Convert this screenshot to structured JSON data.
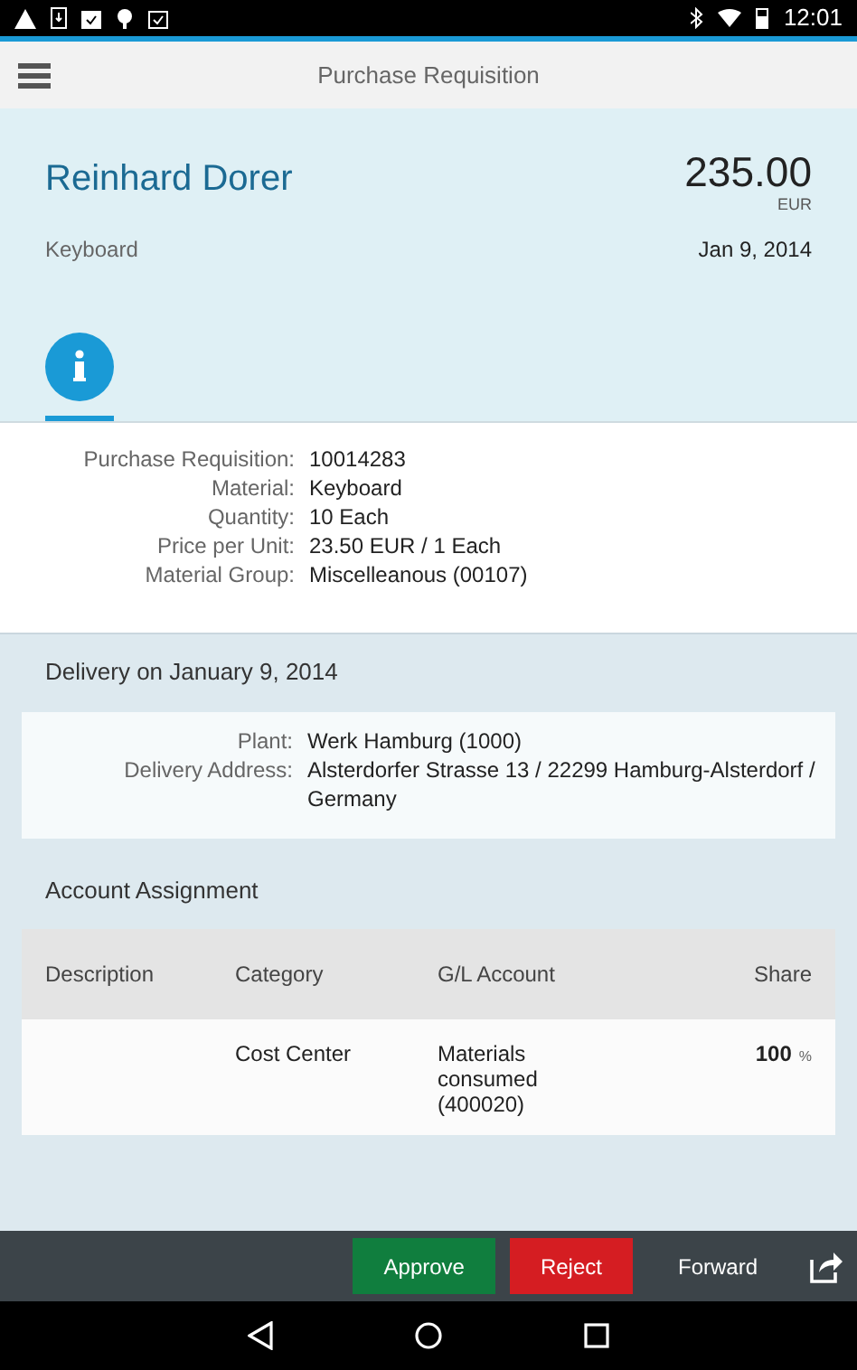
{
  "status_bar": {
    "time": "12:01"
  },
  "header": {
    "title": "Purchase Requisition"
  },
  "summary": {
    "name": "Reinhard Dorer",
    "amount": "235.00",
    "currency": "EUR",
    "item": "Keyboard",
    "date": "Jan 9, 2014"
  },
  "tabs": [
    {
      "kind": "info",
      "selected": true
    }
  ],
  "details": [
    {
      "label": "Purchase Requisition:",
      "value": "10014283"
    },
    {
      "label": "Material:",
      "value": "Keyboard"
    },
    {
      "label": "Quantity:",
      "value": "10 Each"
    },
    {
      "label": "Price per Unit:",
      "value": "23.50 EUR / 1 Each"
    },
    {
      "label": "Material Group:",
      "value": "Miscelleanous (00107)"
    }
  ],
  "delivery": {
    "title": "Delivery on January 9, 2014",
    "fields": [
      {
        "label": "Plant:",
        "value": "Werk Hamburg (1000)"
      },
      {
        "label": "Delivery Address:",
        "value": "Alsterdorfer Strasse 13 / 22299 Hamburg-Alsterdorf / Germany"
      }
    ]
  },
  "account_assignment": {
    "title": "Account Assignment",
    "columns": [
      "Description",
      "Category",
      "G/L Account",
      "Share"
    ],
    "rows": [
      {
        "category": "Cost Center",
        "gl_account": "Materials consumed (400020)",
        "share": "100",
        "unit": "%"
      }
    ]
  },
  "actions": [
    {
      "label": "Approve",
      "kind": "approve"
    },
    {
      "label": "Reject",
      "kind": "reject"
    },
    {
      "label": "Forward",
      "kind": "plain"
    }
  ]
}
